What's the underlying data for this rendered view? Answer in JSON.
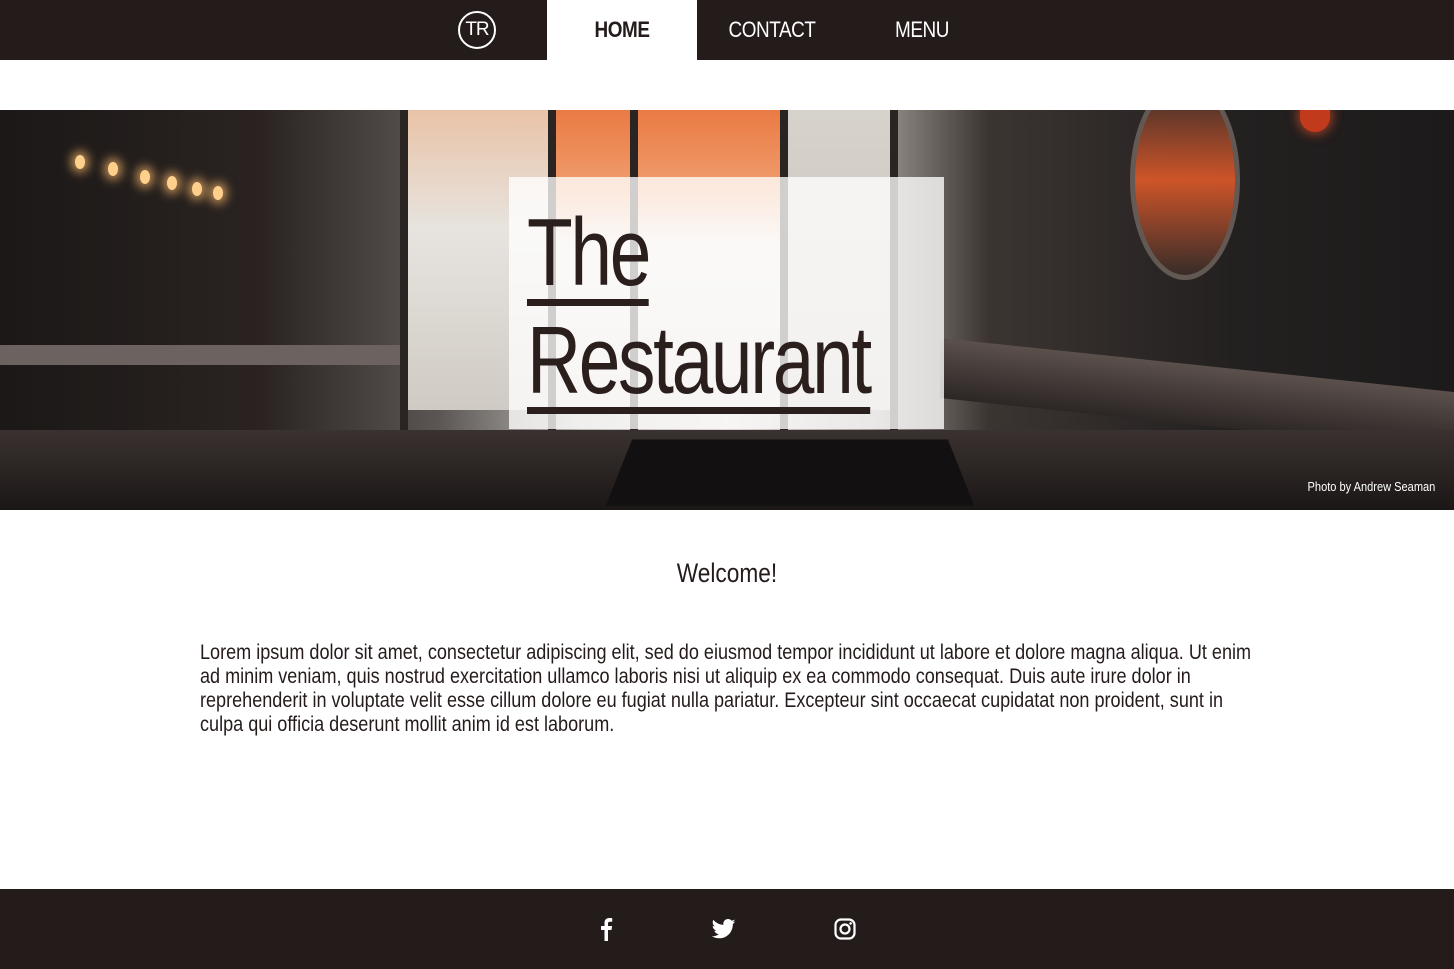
{
  "nav": {
    "logo_text": "TR",
    "items": [
      {
        "label": "HOME",
        "active": true
      },
      {
        "label": "CONTACT",
        "active": false
      },
      {
        "label": "MENU",
        "active": false
      }
    ]
  },
  "hero": {
    "title_line1": "The",
    "title_line2": "Restaurant",
    "photo_credit": "Photo by Andrew Seaman"
  },
  "main": {
    "heading": "Welcome!",
    "paragraph": "Lorem ipsum dolor sit amet, consectetur adipiscing elit, sed do eiusmod tempor incididunt ut labore et dolore magna aliqua. Ut enim ad minim veniam, quis nostrud exercitation ullamco laboris nisi ut aliquip ex ea commodo consequat. Duis aute irure dolor in reprehenderit in voluptate velit esse cillum dolore eu fugiat nulla pariatur. Excepteur sint occaecat cupidatat non proident, sunt in culpa qui officia deserunt mollit anim id est laborum."
  },
  "footer": {
    "social": [
      "facebook-icon",
      "twitter-icon",
      "instagram-icon"
    ]
  },
  "colors": {
    "dark": "#241b1b",
    "white": "#ffffff"
  }
}
